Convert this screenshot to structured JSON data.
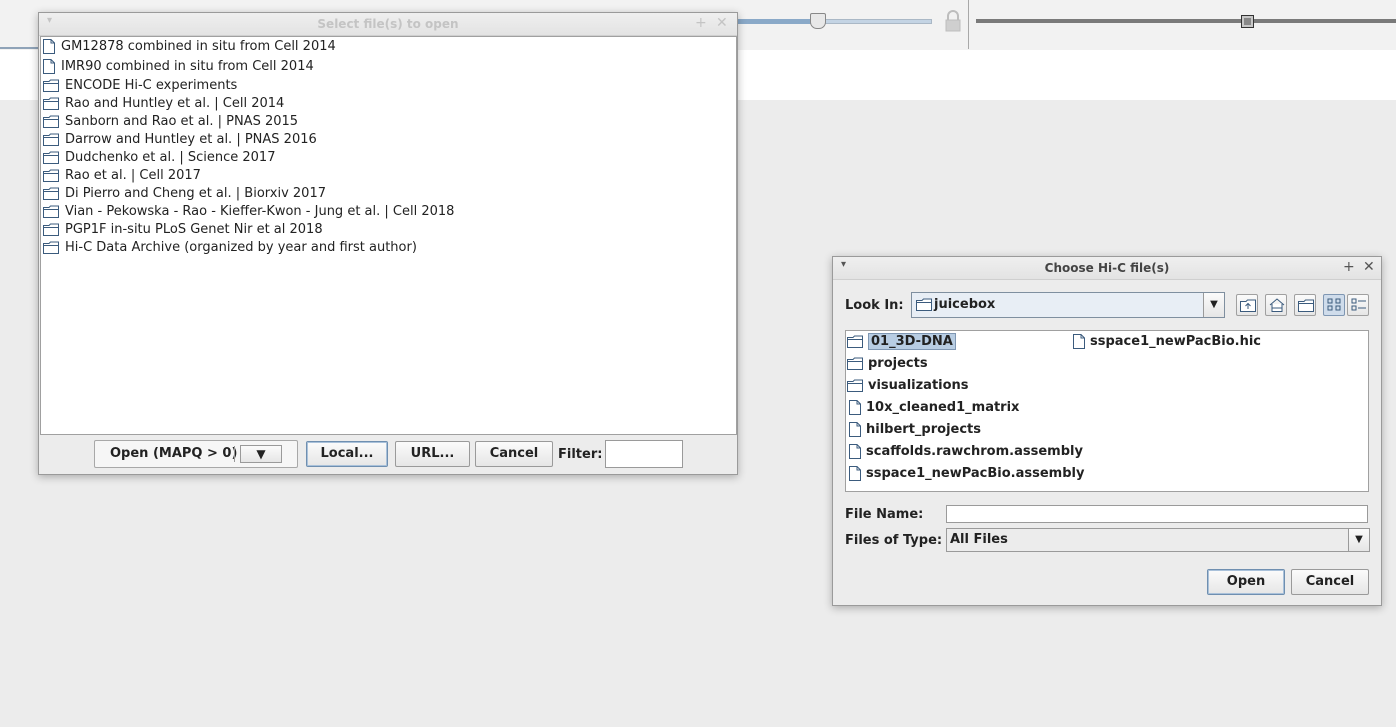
{
  "dialog_open": {
    "title": "Select file(s) to open",
    "items": [
      {
        "label": "GM12878 combined in situ from Cell 2014",
        "type": "file"
      },
      {
        "label": "IMR90 combined in situ from Cell 2014",
        "type": "file"
      },
      {
        "label": "ENCODE Hi-C experiments",
        "type": "folder"
      },
      {
        "label": "Rao and Huntley et al. | Cell 2014",
        "type": "folder"
      },
      {
        "label": "Sanborn and Rao et al. | PNAS 2015",
        "type": "folder"
      },
      {
        "label": "Darrow and Huntley et al. | PNAS 2016",
        "type": "folder"
      },
      {
        "label": "Dudchenko et al. | Science 2017",
        "type": "folder"
      },
      {
        "label": "Rao et al. | Cell 2017",
        "type": "folder"
      },
      {
        "label": "Di Pierro and Cheng et al. | Biorxiv 2017",
        "type": "folder"
      },
      {
        "label": "Vian - Pekowska - Rao - Kieffer-Kwon - Jung et al. | Cell 2018",
        "type": "folder"
      },
      {
        "label": "PGP1F in-situ PLoS Genet Nir et al 2018",
        "type": "folder"
      },
      {
        "label": "Hi-C Data Archive (organized by year and first author)",
        "type": "folder"
      }
    ],
    "open_button": "Open (MAPQ > 0)",
    "dropdown_glyph": "▼",
    "local_button": "Local...",
    "url_button": "URL...",
    "cancel_button": "Cancel",
    "filter_label": "Filter:",
    "filter_value": ""
  },
  "dialog_choose": {
    "title": "Choose Hi-C file(s)",
    "look_in_label": "Look In:",
    "look_in_value": "juicebox",
    "toolbar_icons": [
      "up-folder-icon",
      "home-icon",
      "new-folder-icon",
      "list-view-icon",
      "details-view-icon"
    ],
    "files": [
      {
        "name": "01_3D-DNA",
        "type": "folder",
        "selected": true
      },
      {
        "name": "projects",
        "type": "folder"
      },
      {
        "name": "visualizations",
        "type": "folder"
      },
      {
        "name": "10x_cleaned1_matrix",
        "type": "file"
      },
      {
        "name": "hilbert_projects",
        "type": "file"
      },
      {
        "name": "scaffolds.rawchrom.assembly",
        "type": "file"
      },
      {
        "name": "sspace1_newPacBio.assembly",
        "type": "file"
      },
      {
        "name": "sspace1_newPacBio.hic",
        "type": "file"
      }
    ],
    "file_name_label": "File Name:",
    "file_name_value": "",
    "files_of_type_label": "Files of Type:",
    "files_of_type_value": "All Files",
    "open_button": "Open",
    "cancel_button": "Cancel"
  },
  "colors": {
    "accent": "#7f97b3",
    "selection": "#b8cde3"
  }
}
